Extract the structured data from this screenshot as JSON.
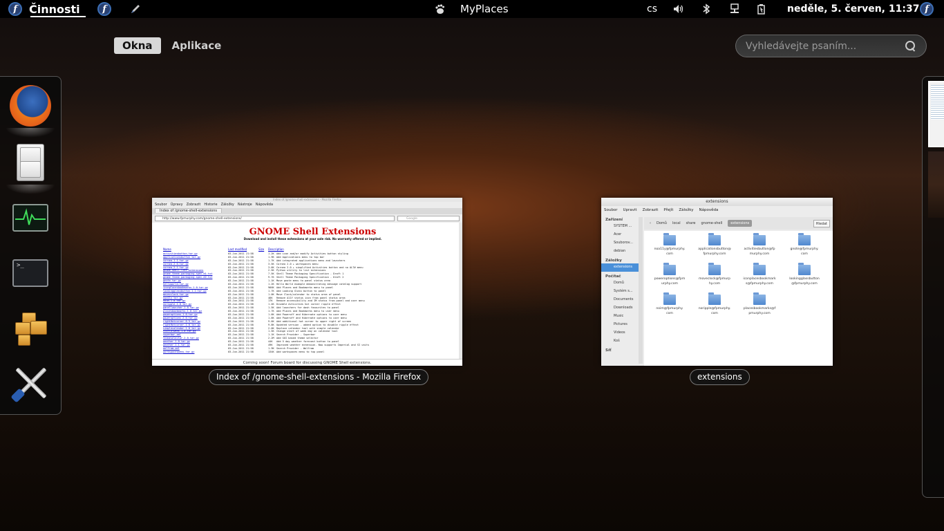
{
  "topbar": {
    "activities": "Činnosti",
    "app_name": "MyPlaces",
    "keyboard_layout": "cs",
    "clock": "neděle,  5. červen, 11:37",
    "icons": [
      "fedora-logo-icon",
      "fedora-logo-icon",
      "pen-icon",
      "gnome-foot-icon",
      "volume-icon",
      "bluetooth-icon",
      "network-icon",
      "battery-icon",
      "fedora-logo-icon"
    ]
  },
  "overview": {
    "tabs": [
      {
        "label": "Okna",
        "active": true
      },
      {
        "label": "Aplikace",
        "active": false
      }
    ],
    "search_placeholder": "Vyhledávejte psaním..."
  },
  "dash": {
    "items": [
      {
        "name": "firefox",
        "icon": "firefox-icon"
      },
      {
        "name": "files",
        "icon": "file-cabinet-icon"
      },
      {
        "name": "system-monitor",
        "icon": "system-monitor-icon"
      },
      {
        "name": "terminal",
        "icon": "terminal-icon"
      },
      {
        "name": "software",
        "icon": "packages-icon"
      },
      {
        "name": "system-tools",
        "icon": "tools-icon"
      }
    ]
  },
  "windows": {
    "firefox": {
      "caption": "Index of /gnome-shell-extensions - Mozilla Firefox",
      "title": "Index of /gnome-shell-extensions - Mozilla Firefox",
      "menu": [
        "Soubor",
        "Úpravy",
        "Zobrazit",
        "Historie",
        "Záložky",
        "Nástroje",
        "Nápověda"
      ],
      "tab": "Index of /gnome-shell-extensions",
      "url": "http://www.fpmurphy.com/gnome-shell-extensions/",
      "search_engine": "Google",
      "heading": "GNOME Shell Extensions",
      "subheading": "Download and install these extensions at your sole risk. No warranty offered or implied.",
      "columns": [
        "Name",
        "Last modified",
        "Size",
        "Description"
      ],
      "rows": [
        {
          "n": "activitiesbutton.tar.gz",
          "d": "03-Jun-2011 21:58",
          "s": "1.2K",
          "desc": "Add icon and/or modify Activities button styling"
        },
        {
          "n": "applicationsbutton.tar.gz",
          "d": "03-Jun-2011 21:58",
          "s": "1.9K",
          "desc": "Add Applications menu to top bar"
        },
        {
          "n": "cornea-1.1.tar.gz",
          "d": "03-Jun-2011 21:58",
          "s": "1.7K",
          "desc": "Add integrated applications menu and launchers"
        },
        {
          "n": "cornea-2.0.tar.gz",
          "d": "03-Jun-2011 21:58",
          "s": "3.5K",
          "desc": "Cornea 2.0 + workspaces menu"
        },
        {
          "n": "cornea-2.1.tar.gz",
          "d": "03-Jun-2011 21:58",
          "s": "3.6K",
          "desc": "Cornea 2.0 + simplified Activities button and no ALT# menu"
        },
        {
          "n": "gnome-shell-list-extensions",
          "d": "03-Jun-2011 21:58",
          "s": "2.5K",
          "desc": "Python utility to list extensions"
        },
        {
          "n": "gnome-theme-packaging-spec-d1.txt",
          "d": "03-Jun-2011 21:58",
          "s": "7.5K",
          "desc": "Shell Theme Packaging Specification - Draft 1"
        },
        {
          "n": "gnome-theme-packaging-spec-d2.txt",
          "d": "03-Jun-2011 21:58",
          "s": "9.7K",
          "desc": "Shell Theme Packaging Specification - Draft 2"
        },
        {
          "n": "gnote.tar.gz",
          "d": "03-Jun-2011 21:58",
          "s": "1.1K",
          "desc": "Move gnote menu to panel status area"
        },
        {
          "n": "helloworld.tar.gz",
          "d": "03-Jun-2011 21:58",
          "s": "1.2K",
          "desc": "Hello World example demonstrating message catalog support"
        },
        {
          "n": "iconplacesbookmarks-1.0.tar.gz",
          "d": "03-Jun-2011 21:58",
          "s": "966K",
          "desc": "Add Places and Bookmarks menu to panel"
        },
        {
          "n": "lookingglassbutton-1.1.tar.gz",
          "d": "03-Jun-2011 21:58",
          "s": "1.7K",
          "desc": "Add Looking Glass button to panel"
        },
        {
          "n": "movecclock.tar.gz",
          "d": "03-Jun-2011 21:58",
          "s": "1.0K",
          "desc": "Move Clock/calendar to status area of panel"
        },
        {
          "n": "noa11y.tar.gz",
          "d": "03-Jun-2011 21:58",
          "s": "46K",
          "desc": "Remove A11Y status icon from panel status area"
        },
        {
          "n": "noim-1.0.tar.gz",
          "d": "03-Jun-2011 21:58",
          "s": "17K",
          "desc": "Remove accessibility and IM status from panel and user menu"
        },
        {
          "n": "noripple-1.0.tar.gz",
          "d": "03-Jun-2011 21:58",
          "s": "1.4K",
          "desc": "Disable Activities hot corner ripple effect"
        },
        {
          "n": "panellauncher-1.0.tar.gz",
          "d": "03-Jun-2011 21:58",
          "s": "1.5K",
          "desc": "Add launchers for dash favourites to panel"
        },
        {
          "n": "placesbookmarks-1.0.tar.gz",
          "d": "03-Jun-2011 21:58",
          "s": "1.7K",
          "desc": "Add Places and Bookmarks menu to user menu"
        },
        {
          "n": "poweroptions-1.0.tar.gz",
          "d": "03-Jun-2011 21:58",
          "s": "1.6K",
          "desc": "Add Poweroff and Hibernate options to user menu"
        },
        {
          "n": "poweroptions-2.0.tar.gz",
          "d": "03-Jun-2011 21:58",
          "s": "1.6K",
          "desc": "Add Poweroff and Hibernate options to user menu"
        },
        {
          "n": "rightHotcorner-0.5.tar.gz",
          "d": "03-Jun-2011 21:58",
          "s": "9.6K",
          "desc": "Add additional hot corner to upper right of screen"
        },
        {
          "n": "rightHotcorner-1.0.tar.gz",
          "d": "03-Jun-2011 21:58",
          "s": "9.8K",
          "desc": "Updated version - added option to disable ripple effect"
        },
        {
          "n": "simplecalendar-1.0.tar.gz",
          "d": "03-Jun-2011 21:58",
          "s": "2.0K",
          "desc": "Replace calendar tool with simple calendar"
        },
        {
          "n": "startofweek-1.0.tar.gz",
          "d": "03-Jun-2011 21:58",
          "s": "1.5K",
          "desc": "Change start of week day on calendar tool"
        },
        {
          "n": "superbar.xml",
          "d": "03-Jun-2011 21:58",
          "s": "1.1K",
          "desc": "Search Provider - Superbar"
        },
        {
          "n": "themeselector-2.0.tar.gz",
          "d": "03-Jun-2011 21:58",
          "s": "2.2M",
          "desc": "Add GUI based theme selector"
        },
        {
          "n": "weather-1.0.tar.gz",
          "d": "03-Jun-2011 21:58",
          "s": "44K",
          "desc": "Add 5 day weather forecast button to panel"
        },
        {
          "n": "weather-1.1.tar.gz",
          "d": "03-Jun-2011 21:58",
          "s": "49K",
          "desc": "Improved weather extension. Now supports Imperial and SI units"
        },
        {
          "n": "wolfram.xml",
          "d": "03-Jun-2011 21:58",
          "s": "1.9K",
          "desc": "Search Provider - Wolfram"
        },
        {
          "n": "workspacesmenu.tar.gz",
          "d": "03-Jun-2011 21:58",
          "s": "134K",
          "desc": "Add workspaces menu to top panel"
        }
      ],
      "footer": "Coming soon! Forum board for discussing GNOME Shell extensions."
    },
    "nautilus": {
      "caption": "extensions",
      "title": "extensions",
      "menu": [
        "Soubor",
        "Upravit",
        "Zobrazit",
        "Přejít",
        "Záložky",
        "Nápověda"
      ],
      "sidebar": [
        {
          "type": "header",
          "label": "Zařízení"
        },
        {
          "type": "item",
          "label": "SYSTEM ..."
        },
        {
          "type": "item",
          "label": "Acer"
        },
        {
          "type": "item",
          "label": "Souborov..."
        },
        {
          "type": "item",
          "label": "debian"
        },
        {
          "type": "header",
          "label": "Záložky"
        },
        {
          "type": "item",
          "label": "extensions",
          "selected": true
        },
        {
          "type": "header",
          "label": "Počítač"
        },
        {
          "type": "item",
          "label": "Domů"
        },
        {
          "type": "item",
          "label": "Systém s..."
        },
        {
          "type": "item",
          "label": "Documents"
        },
        {
          "type": "item",
          "label": "Downloads"
        },
        {
          "type": "item",
          "label": "Music"
        },
        {
          "type": "item",
          "label": "Pictures"
        },
        {
          "type": "item",
          "label": "Videos"
        },
        {
          "type": "item",
          "label": "Koš"
        },
        {
          "type": "header",
          "label": "Síť"
        }
      ],
      "path": [
        "Domů",
        "local",
        "share",
        "gnome-shell",
        "extensions"
      ],
      "find_label": "Hledat",
      "folders": [
        {
          "l1": "noa11y@fpmurphy.",
          "l2": "com"
        },
        {
          "l1": "applicationsbutton@",
          "l2": "fpmurphy.com"
        },
        {
          "l1": "activitiesbutton@fp",
          "l2": "murphy.com"
        },
        {
          "l1": "gnote@fpmurphy.",
          "l2": "com"
        },
        {
          "l1": "poweroptions@fpm",
          "l2": "urphy.com"
        },
        {
          "l1": "moveclock@fpmurp",
          "l2": "hy.com"
        },
        {
          "l1": "iconplacesbookmark",
          "l2": "s@fpmurphy.com"
        },
        {
          "l1": "lookingglassbutton",
          "l2": "@fpmurphy.com"
        },
        {
          "l1": "noim@fpmurphy.",
          "l2": "com"
        },
        {
          "l1": "noripple@fpmurphy.",
          "l2": "com"
        },
        {
          "l1": "placesbookmarks@f",
          "l2": "pmurphy.com"
        }
      ]
    }
  }
}
